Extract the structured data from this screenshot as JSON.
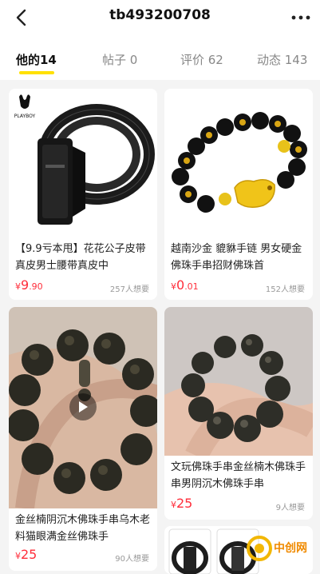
{
  "header": {
    "title": "tb493200708",
    "back_icon": "chevron-left-icon",
    "more_icon": "ellipsis-icon"
  },
  "tabs": [
    {
      "label": "他的14"
    },
    {
      "label": "帖子 0"
    },
    {
      "label": "评价 62"
    },
    {
      "label": "动态 143"
    }
  ],
  "products": [
    {
      "title": "【9.9亏本甩】花花公子皮带真皮男士腰带真皮中",
      "price_currency": "¥",
      "price_int": "9",
      "price_dec": ".90",
      "wants": "257人想要",
      "brand": "PLAYBOY"
    },
    {
      "title": "越南沙金 貔貅手链 男女硬金佛珠手串招财佛珠首",
      "price_currency": "¥",
      "price_int": "0",
      "price_dec": ".01",
      "wants": "152人想要"
    },
    {
      "title": "金丝楠阴沉木佛珠手串乌木老料猫眼满金丝佛珠手",
      "price_currency": "¥",
      "price_int": "25",
      "price_dec": "",
      "wants": "90人想要"
    },
    {
      "title": "文玩佛珠手串金丝楠木佛珠手串男阴沉木佛珠手串",
      "price_currency": "¥",
      "price_int": "25",
      "price_dec": "",
      "wants": "9人想要"
    }
  ],
  "watermark": {
    "text": "中创网"
  },
  "colors": {
    "accent": "#ffe100",
    "price": "#ff2d3a"
  }
}
